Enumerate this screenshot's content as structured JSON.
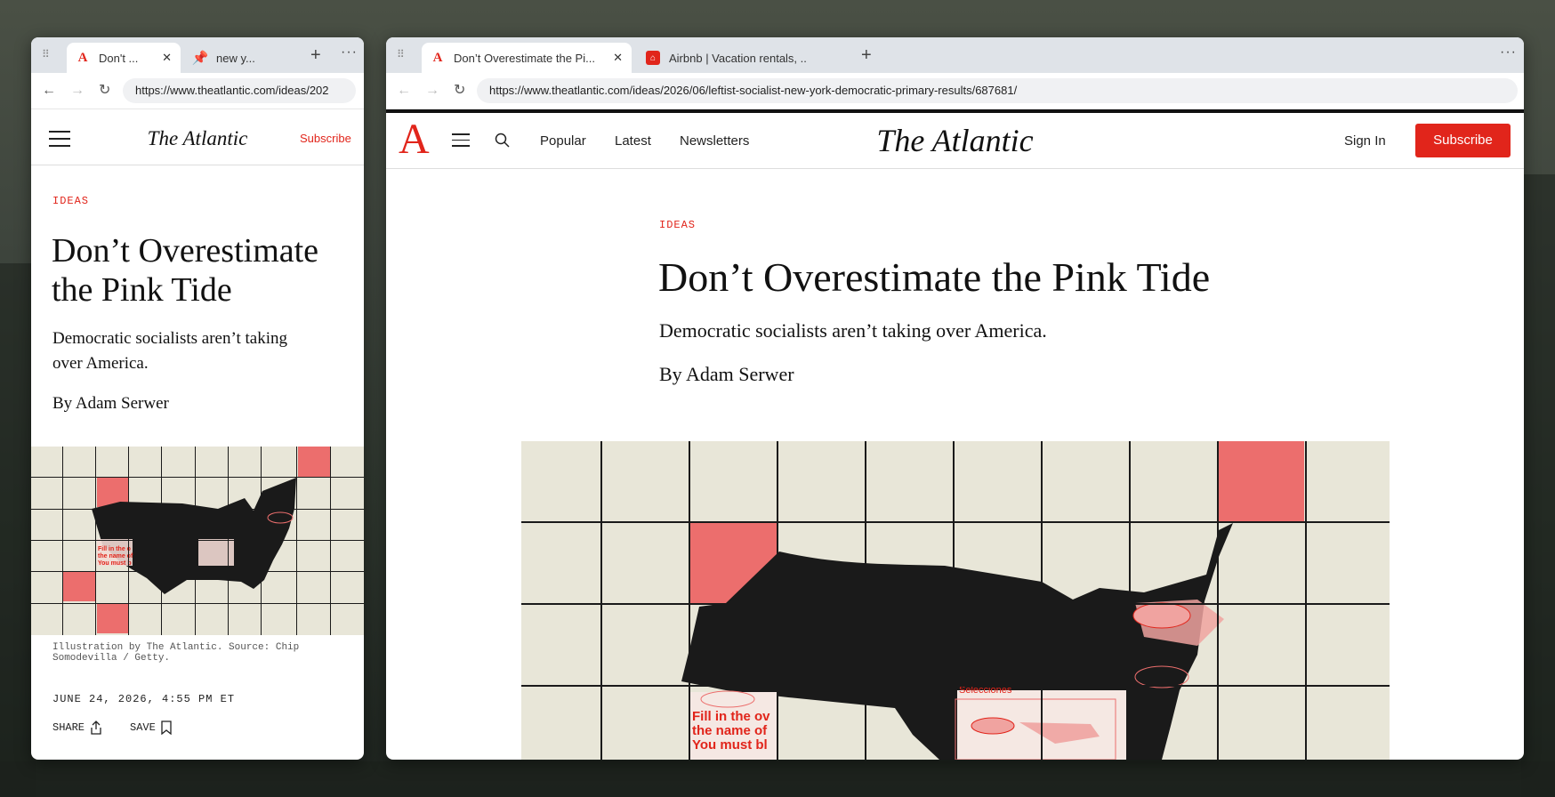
{
  "left_window": {
    "tabs": [
      {
        "title": "Don't ...",
        "favicon": "atlantic-a-icon"
      },
      {
        "title": "new y...",
        "favicon": "pin-icon"
      }
    ],
    "url": "https://www.theatlantic.com/ideas/202",
    "header": {
      "logo": "The Atlantic",
      "subscribe": "Subscribe"
    },
    "article": {
      "section": "IDEAS",
      "title_line1": "Don’t Overestimate",
      "title_line2": "the Pink Tide",
      "dek_line1": "Democratic socialists aren’t taking",
      "dek_line2": "over America.",
      "byline": "By Adam Serwer",
      "caption_line1": "Illustration by The Atlantic. Source: Chip",
      "caption_line2": "Somodevilla / Getty.",
      "date": "JUNE 24, 2026, 4:55 PM ET",
      "share": "SHARE",
      "save": "SAVE"
    }
  },
  "right_window": {
    "tabs": [
      {
        "title": "Don’t Overestimate the Pi...",
        "favicon": "atlantic-a-icon"
      },
      {
        "title": "Airbnb | Vacation rentals, ...",
        "favicon": "airbnb-icon"
      }
    ],
    "url": "https://www.theatlantic.com/ideas/2026/06/leftist-socialist-new-york-democratic-primary-results/687681/",
    "header": {
      "logo_letter": "A",
      "nav": [
        "Popular",
        "Latest",
        "Newsletters"
      ],
      "logo": "The Atlantic",
      "sign_in": "Sign In",
      "subscribe": "Subscribe"
    },
    "article": {
      "section": "IDEAS",
      "title": "Don’t Overestimate the Pink Tide",
      "dek": "Democratic socialists aren’t taking over America.",
      "byline": "By Adam Serwer"
    },
    "illustration_text": {
      "selecciones": "Selecciones",
      "fill_line1": "Fill in the ov",
      "fill_line2": "the name of",
      "fill_line3": "You must bl"
    }
  },
  "left_illustration_text": {
    "fill_line1": "Fill in the o",
    "fill_line2": "the name of",
    "fill_line3": "You must b"
  },
  "colors": {
    "brand_red": "#e1251b",
    "grid_red": "#ec6e6d",
    "paper": "#e8e6d8"
  }
}
